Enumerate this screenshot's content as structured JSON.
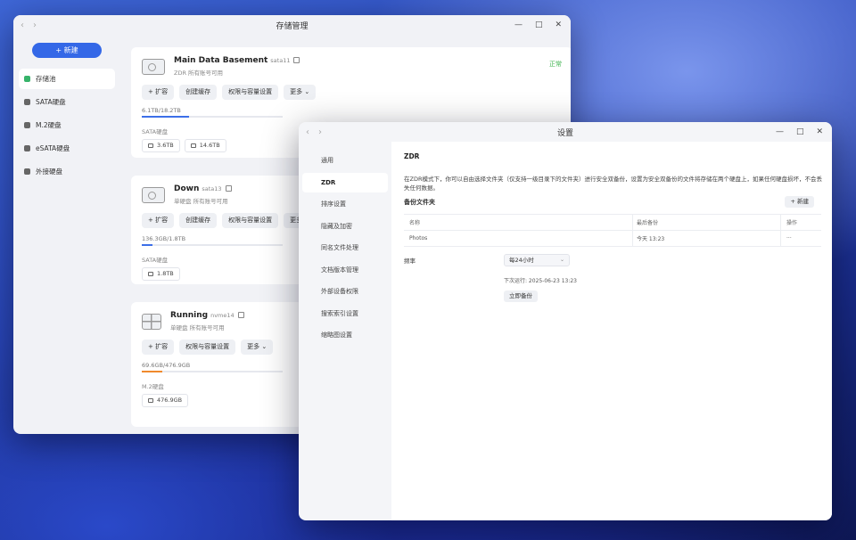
{
  "storage_window": {
    "title": "存储管理",
    "nav_back": "‹",
    "nav_forward": "›",
    "controls": {
      "minimize": "—",
      "maximize": "□",
      "close": "✕"
    },
    "new_button": "+ 新建",
    "sidebar": [
      {
        "label": "存储池",
        "icon": "storage-pool-icon",
        "active": true
      },
      {
        "label": "SATA硬盘",
        "icon": "drive-icon"
      },
      {
        "label": "M.2硬盘",
        "icon": "drive-icon"
      },
      {
        "label": "eSATA硬盘",
        "icon": "drive-icon"
      },
      {
        "label": "外接硬盘",
        "icon": "drive-icon"
      }
    ],
    "pools": [
      {
        "name": "Main Data Basement",
        "device": "sata11",
        "sub": "ZDR  所有账号可用",
        "status": "正常",
        "buttons": [
          "+ 扩容",
          "创建缓存",
          "权限与容量设置",
          "更多 ⌄"
        ],
        "capacity_text": "6.1TB/18.2TB",
        "usage_fraction": 0.335,
        "bar_color": "#3c6fe8",
        "type_label": "SATA硬盘",
        "disks": [
          "3.6TB",
          "14.6TB"
        ]
      },
      {
        "name": "Down",
        "device": "sata13",
        "sub": "单硬盘  所有账号可用",
        "buttons": [
          "+ 扩容",
          "创建缓存",
          "权限与容量设置",
          "更多"
        ],
        "capacity_text": "136.3GB/1.8TB",
        "usage_fraction": 0.074,
        "bar_color": "#3c6fe8",
        "type_label": "SATA硬盘",
        "disks": [
          "1.8TB"
        ]
      },
      {
        "name": "Running",
        "device": "nvme14",
        "sub": "单硬盘  所有账号可用",
        "buttons": [
          "+ 扩容",
          "权限与容量设置",
          "更多 ⌄"
        ],
        "capacity_text": "69.6GB/476.9GB",
        "usage_fraction": 0.146,
        "bar_color": "#f08a2c",
        "type_label": "M.2硬盘",
        "disks": [
          "476.9GB"
        ]
      }
    ]
  },
  "settings_window": {
    "title": "设置",
    "nav_back": "‹",
    "nav_forward": "›",
    "controls": {
      "minimize": "—",
      "maximize": "□",
      "close": "✕"
    },
    "menu": [
      "通用",
      "ZDR",
      "排序设置",
      "隐藏及加密",
      "同名文件处理",
      "文档版本管理",
      "外部设备权限",
      "搜索索引设置",
      "缩略图设置"
    ],
    "active_menu_index": 1,
    "heading": "ZDR",
    "description": "在ZDR模式下，你可以自由选择文件夹（仅支持一级目录下的文件夹）进行安全双备份，设置为安全双备份的文件将存储在两个硬盘上，如果任何硬盘损坏，不会丢失任何数据。",
    "backup_folders_title": "备份文件夹",
    "new_button": "+ 新建",
    "table": {
      "headers": [
        "名称",
        "最后备份",
        "操作"
      ],
      "rows": [
        {
          "name": "Photos",
          "last_backup": "今天 13:23",
          "action": "···"
        }
      ]
    },
    "frequency_label": "频率",
    "frequency_value": "每24小时",
    "next_run": "下次运行: 2025-06-23 13:23",
    "backup_now": "立即备份"
  }
}
